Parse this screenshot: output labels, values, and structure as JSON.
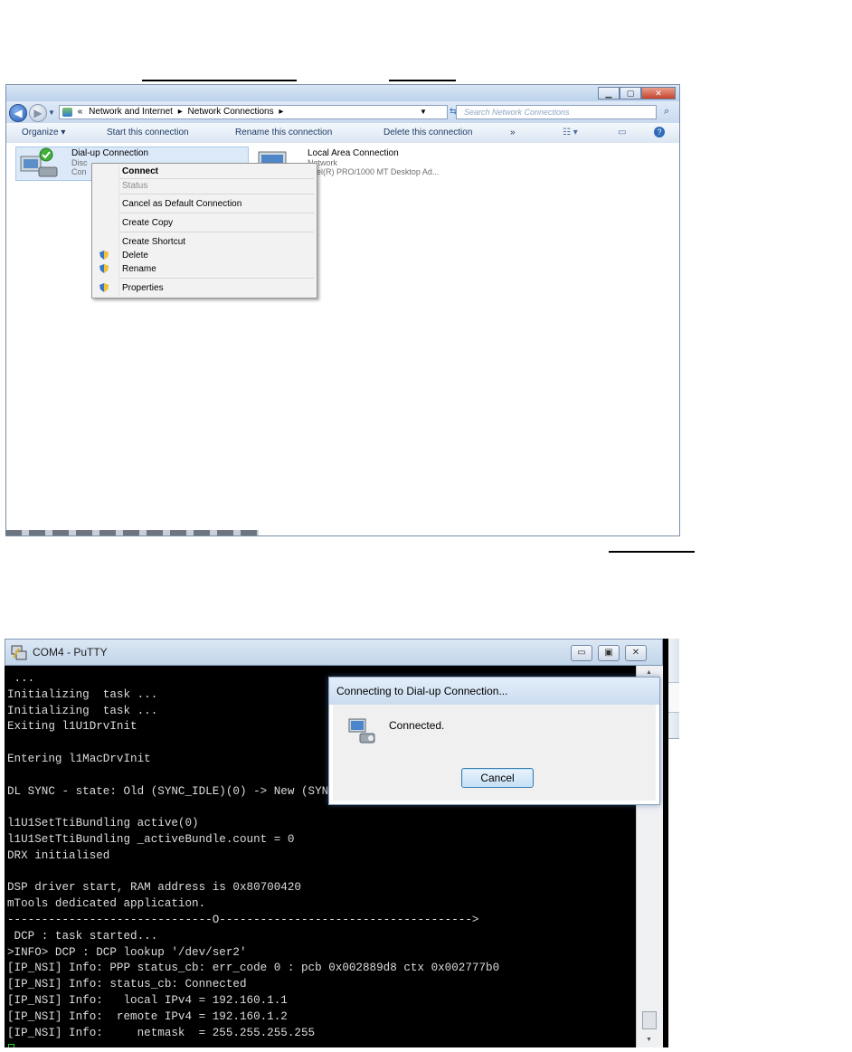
{
  "explorer": {
    "breadcrumb": {
      "prefix": "«",
      "items": [
        "Network and Internet",
        "Network Connections"
      ],
      "sep": "▸"
    },
    "search_placeholder": "Search Network Connections",
    "toolbar": {
      "organize": "Organize ▾",
      "start": "Start this connection",
      "rename": "Rename this connection",
      "delete": "Delete this connection",
      "more": "»"
    },
    "connections": [
      {
        "title": "Dial-up Connection",
        "line1": "Disc",
        "line2": "Con"
      },
      {
        "title": "Local Area Connection",
        "line1": "Network",
        "line2": "Intel(R) PRO/1000 MT Desktop Ad..."
      }
    ],
    "context_menu": {
      "connect": "Connect",
      "status": "Status",
      "cancel_default": "Cancel as Default Connection",
      "create_copy": "Create Copy",
      "create_shortcut": "Create Shortcut",
      "delete": "Delete",
      "rename": "Rename",
      "properties": "Properties"
    }
  },
  "putty": {
    "title": "COM4 - PuTTY",
    "terminal_lines": [
      " ...",
      "Initializing  task ...",
      "Initializing  task ...",
      "Exiting l1U1DrvInit",
      "",
      "Entering l1MacDrvInit",
      "",
      "DL SYNC - state: Old (SYNC_IDLE)(0) -> New (SYNC_ACTIVE)(1)",
      "",
      "l1U1SetTtiBundling active(0)",
      "l1U1SetTtiBundling _activeBundle.count = 0",
      "DRX initialised",
      "",
      "DSP driver start, RAM address is 0x80700420",
      "mTools dedicated application.",
      "------------------------------O------------------------------------->",
      " DCP : task started...",
      ">INFO> DCP : DCP lookup '/dev/ser2'",
      "[IP_NSI] Info: PPP status_cb: err_code 0 : pcb 0x002889d8 ctx 0x002777b0",
      "[IP_NSI] Info: status_cb: Connected",
      "[IP_NSI] Info:   local IPv4 = 192.160.1.1",
      "[IP_NSI] Info:  remote IPv4 = 192.160.1.2",
      "[IP_NSI] Info:     netmask  = 255.255.255.255"
    ]
  },
  "dialog": {
    "title": "Connecting to Dial-up Connection...",
    "message": "Connected.",
    "cancel": "Cancel"
  }
}
